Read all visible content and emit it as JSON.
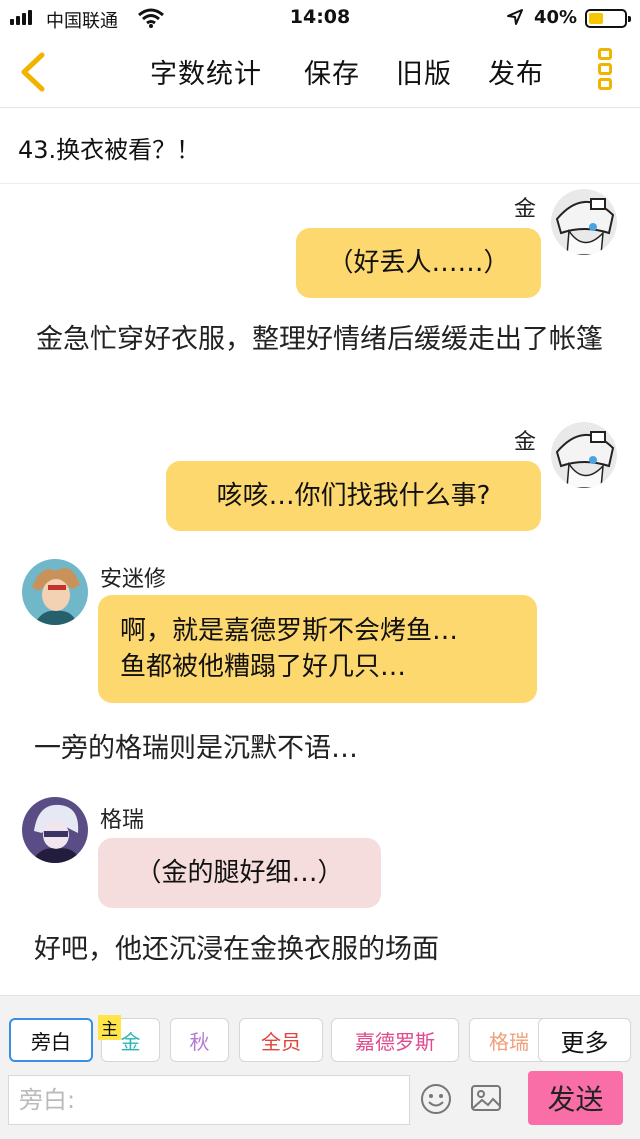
{
  "status_bar": {
    "carrier": "中国联通",
    "time": "14:08",
    "battery": "40%",
    "battery_level": 0.4
  },
  "toolbar": {
    "back_icon": "chevron-left-icon",
    "word_count": "字数统计",
    "save": "保存",
    "old_version": "旧版",
    "publish": "发布",
    "more_icon": "vertical-dots-icon",
    "accent_color": "#f0b400"
  },
  "chapter": {
    "title": "43.换衣被看？！"
  },
  "messages": [
    {
      "type": "right",
      "speaker": "金",
      "text": "（好丢人……）"
    },
    {
      "type": "narration",
      "text": "金急忙穿好衣服，整理好情绪后缓缓走出了帐篷"
    },
    {
      "type": "right",
      "speaker": "金",
      "text": "咳咳…你们找我什么事?"
    },
    {
      "type": "left",
      "speaker": "安迷修",
      "lines": [
        "啊，就是嘉德罗斯不会烤鱼…",
        "鱼都被他糟蹋了好几只…"
      ]
    },
    {
      "type": "narration",
      "text": "一旁的格瑞则是沉默不语…"
    },
    {
      "type": "left",
      "speaker": "格瑞",
      "text": "（金的腿好细…）"
    },
    {
      "type": "narration",
      "text": "好吧，他还沉浸在金换衣服的场面"
    }
  ],
  "roles": [
    {
      "label": "旁白",
      "color": "#111111"
    },
    {
      "label": "金",
      "badge": "主",
      "color": "#2bb5b0"
    },
    {
      "label": "秋",
      "color": "#b57ad8"
    },
    {
      "label": "全员",
      "color": "#e0453a"
    },
    {
      "label": "嘉德罗斯",
      "color": "#e04a8e"
    },
    {
      "label": "格瑞",
      "color": "#f0a07a"
    },
    {
      "label": "更多",
      "color": "#111111"
    }
  ],
  "input": {
    "placeholder": "旁白:",
    "send": "发送"
  },
  "colors": {
    "bubble_yellow": "#fdd86e",
    "bubble_pink": "#f5dddd",
    "send_button": "#fa6ea8"
  }
}
